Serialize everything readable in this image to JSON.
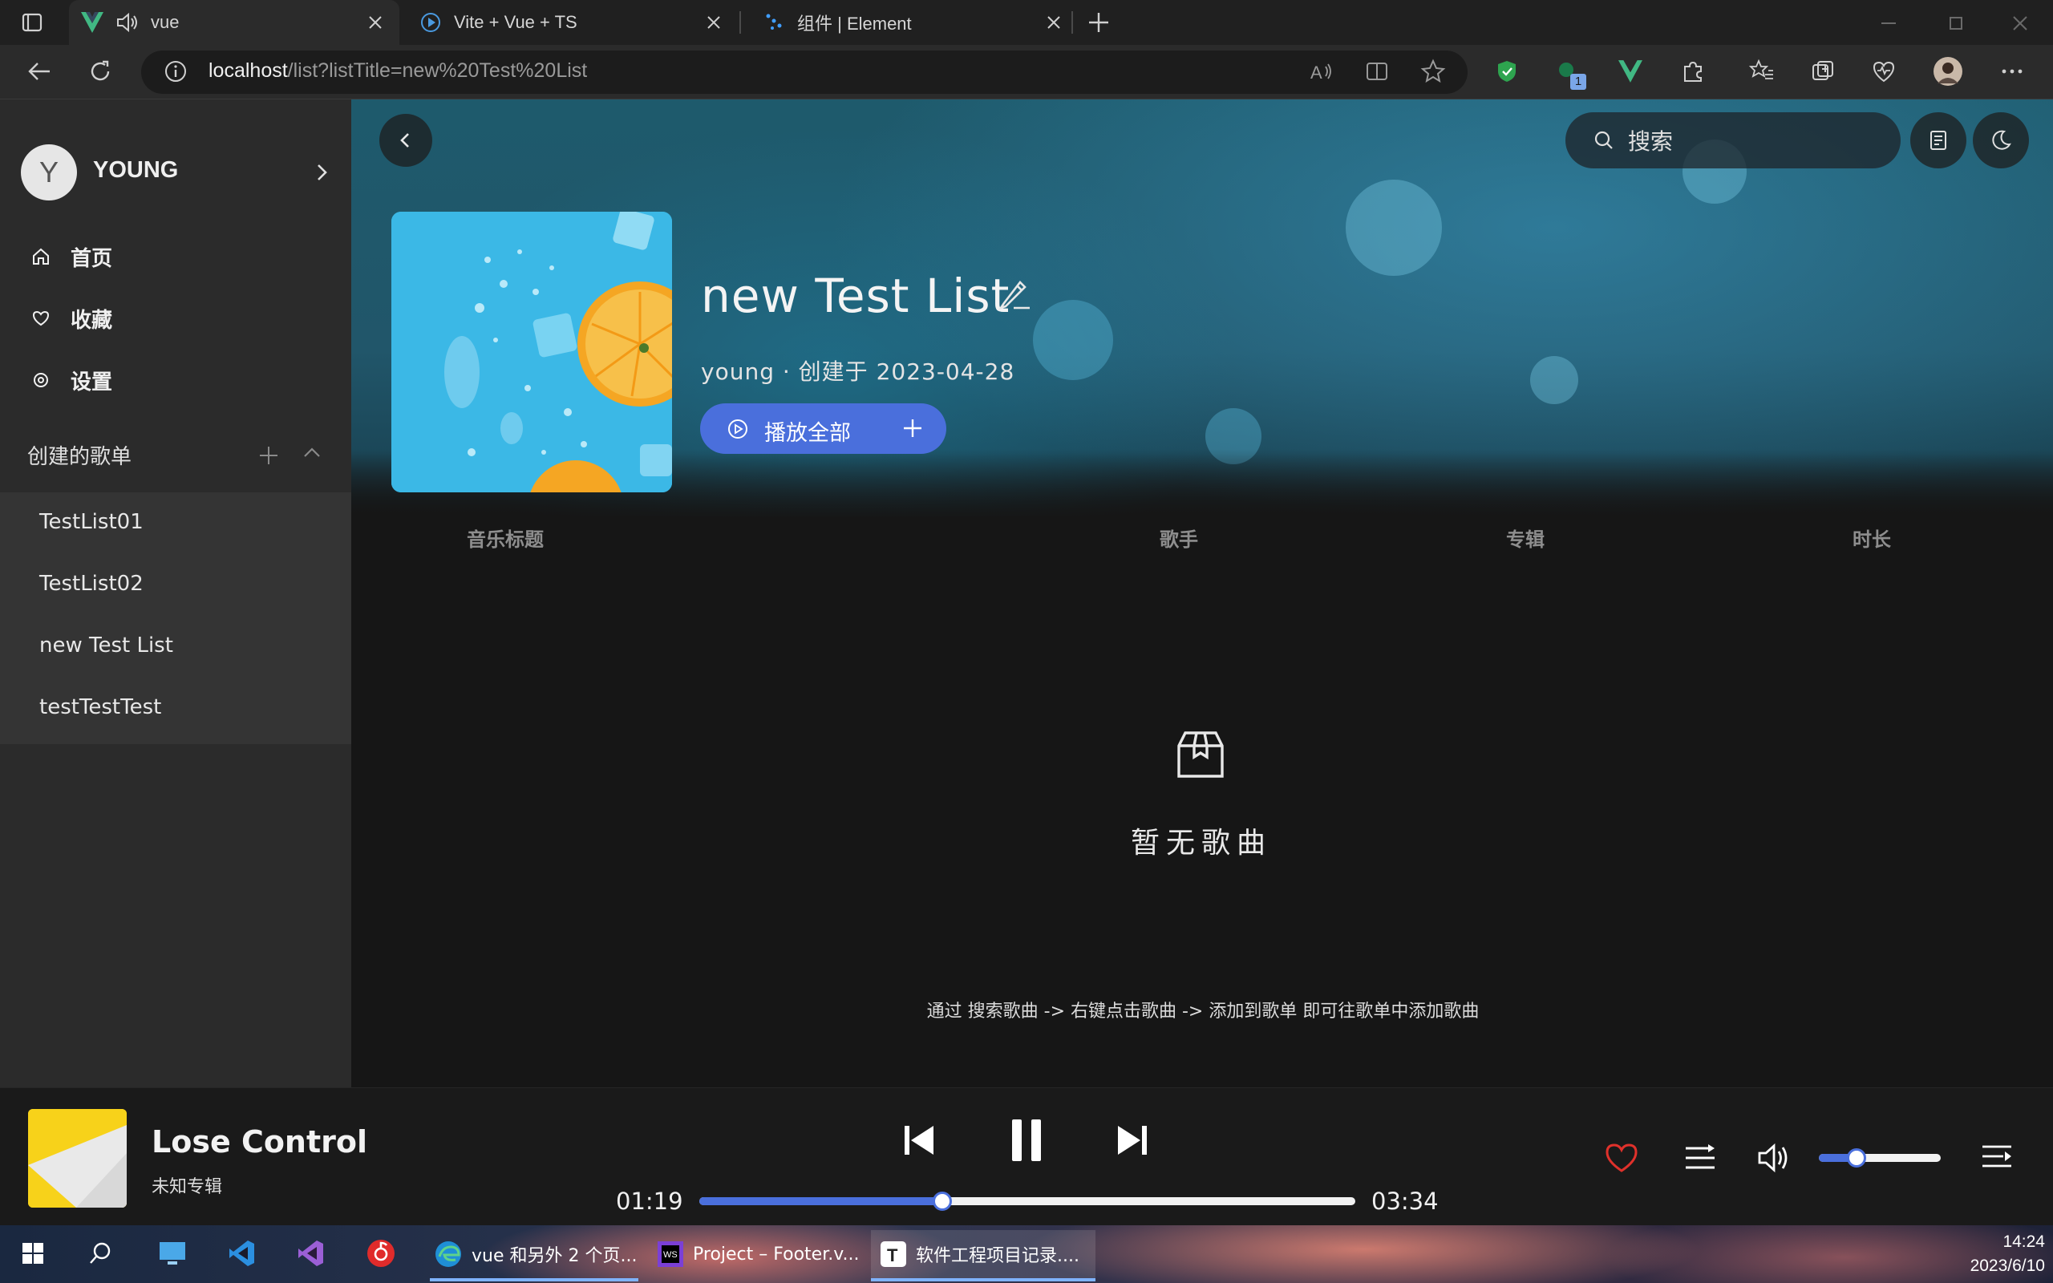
{
  "browser": {
    "tabs": [
      {
        "title": "vue",
        "active": true
      },
      {
        "title": "Vite + Vue + TS",
        "active": false
      },
      {
        "title": "组件 | Element",
        "active": false
      }
    ],
    "url_host": "localhost",
    "url_path": "/list?listTitle=new%20Test%20List",
    "extension_badge": "1"
  },
  "sidebar": {
    "avatar_letter": "Y",
    "username": "YOUNG",
    "nav": [
      {
        "label": "首页",
        "icon": "home-icon"
      },
      {
        "label": "收藏",
        "icon": "heart-icon"
      },
      {
        "label": "设置",
        "icon": "settings-icon"
      }
    ],
    "playlists_header": "创建的歌单",
    "playlists": [
      "TestList01",
      "TestList02",
      "new Test List",
      "testTestTest"
    ]
  },
  "header": {
    "search_placeholder": "搜索"
  },
  "playlist": {
    "title": "new Test List",
    "meta": "young · 创建于 2023-04-28",
    "play_all_label": "播放全部",
    "columns": [
      "音乐标题",
      "歌手",
      "专辑",
      "时长"
    ],
    "empty_text": "暂无歌曲",
    "hint": "通过 搜索歌曲 -> 右键点击歌曲 -> 添加到歌单 即可往歌单中添加歌曲"
  },
  "player": {
    "song_title": "Lose Control",
    "album": "未知专辑",
    "current_time": "01:19",
    "total_time": "03:34",
    "progress": 0.37,
    "volume": 0.31,
    "liked": true,
    "accent_color": "#4a6fdc",
    "like_color": "#e0312b"
  },
  "taskbar": {
    "apps": [
      "vue 和另外 2 个页...",
      "Project – Footer.v...",
      "软件工程项目记录...."
    ],
    "time": "14:24",
    "date": "2023/6/10"
  }
}
